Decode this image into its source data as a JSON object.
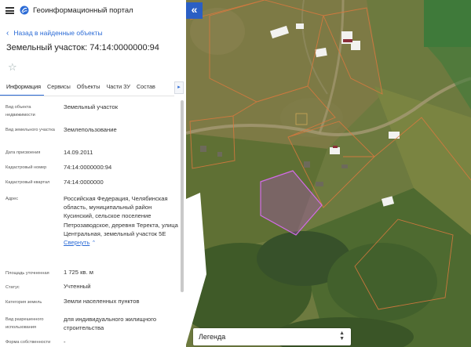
{
  "app": {
    "title": "Геоинформационный портал"
  },
  "nav": {
    "back_label": "Назад в найденные объекты"
  },
  "object": {
    "title": "Земельный участок: 74:14:0000000:94"
  },
  "tabs": [
    {
      "label": "Информация",
      "active": true
    },
    {
      "label": "Сервисы"
    },
    {
      "label": "Объекты"
    },
    {
      "label": "Части ЗУ"
    },
    {
      "label": "Состав"
    }
  ],
  "attributes": [
    {
      "label": "Вид объекта недвижимости",
      "value": "Земельный участок"
    },
    {
      "label": "Вид земельного участка",
      "value": "Землепользование"
    },
    {
      "label": "Дата присвоения",
      "value": "14.09.2011"
    },
    {
      "label": "Кадастровый номер",
      "value": "74:14:0000000:94"
    },
    {
      "label": "Кадастровый квартал",
      "value": "74:14:0000000"
    },
    {
      "label": "Адрес",
      "value": "Российская Федерация, Челябинская область, муниципальный район Кусинский, сельское поселение Петрозаводское, деревня Теректа, улица Центральная, земельный участок 5Е",
      "collapse_label": "Свернуть"
    },
    {
      "label": "Площадь уточненная",
      "value": "1 725 кв. м"
    },
    {
      "label": "Статус",
      "value": "Учтенный"
    },
    {
      "label": "Категория земель",
      "value": "Земли населенных пунктов"
    },
    {
      "label": "Вид разрешенного использования",
      "value": "для индивидуального жилищного строительства"
    },
    {
      "label": "Форма собственности",
      "value": "-"
    }
  ],
  "map": {
    "collapse_glyph": "«",
    "legend_label": "Легенда"
  },
  "icons": {
    "menu": "hamburger-menu-icon",
    "logo": "portal-logo-icon",
    "back": "chevron-left-icon",
    "favorite": "star-icon",
    "tabs_more": "chevron-right-icon",
    "collapse_up": "chevron-up-icon",
    "legend": "chevron-updown-icon"
  },
  "colors": {
    "accent": "#2b6bd6",
    "collapse_button": "#2b5fc4",
    "parcel_outline": "#d9793f",
    "selected_parcel": "#b04fc4"
  }
}
